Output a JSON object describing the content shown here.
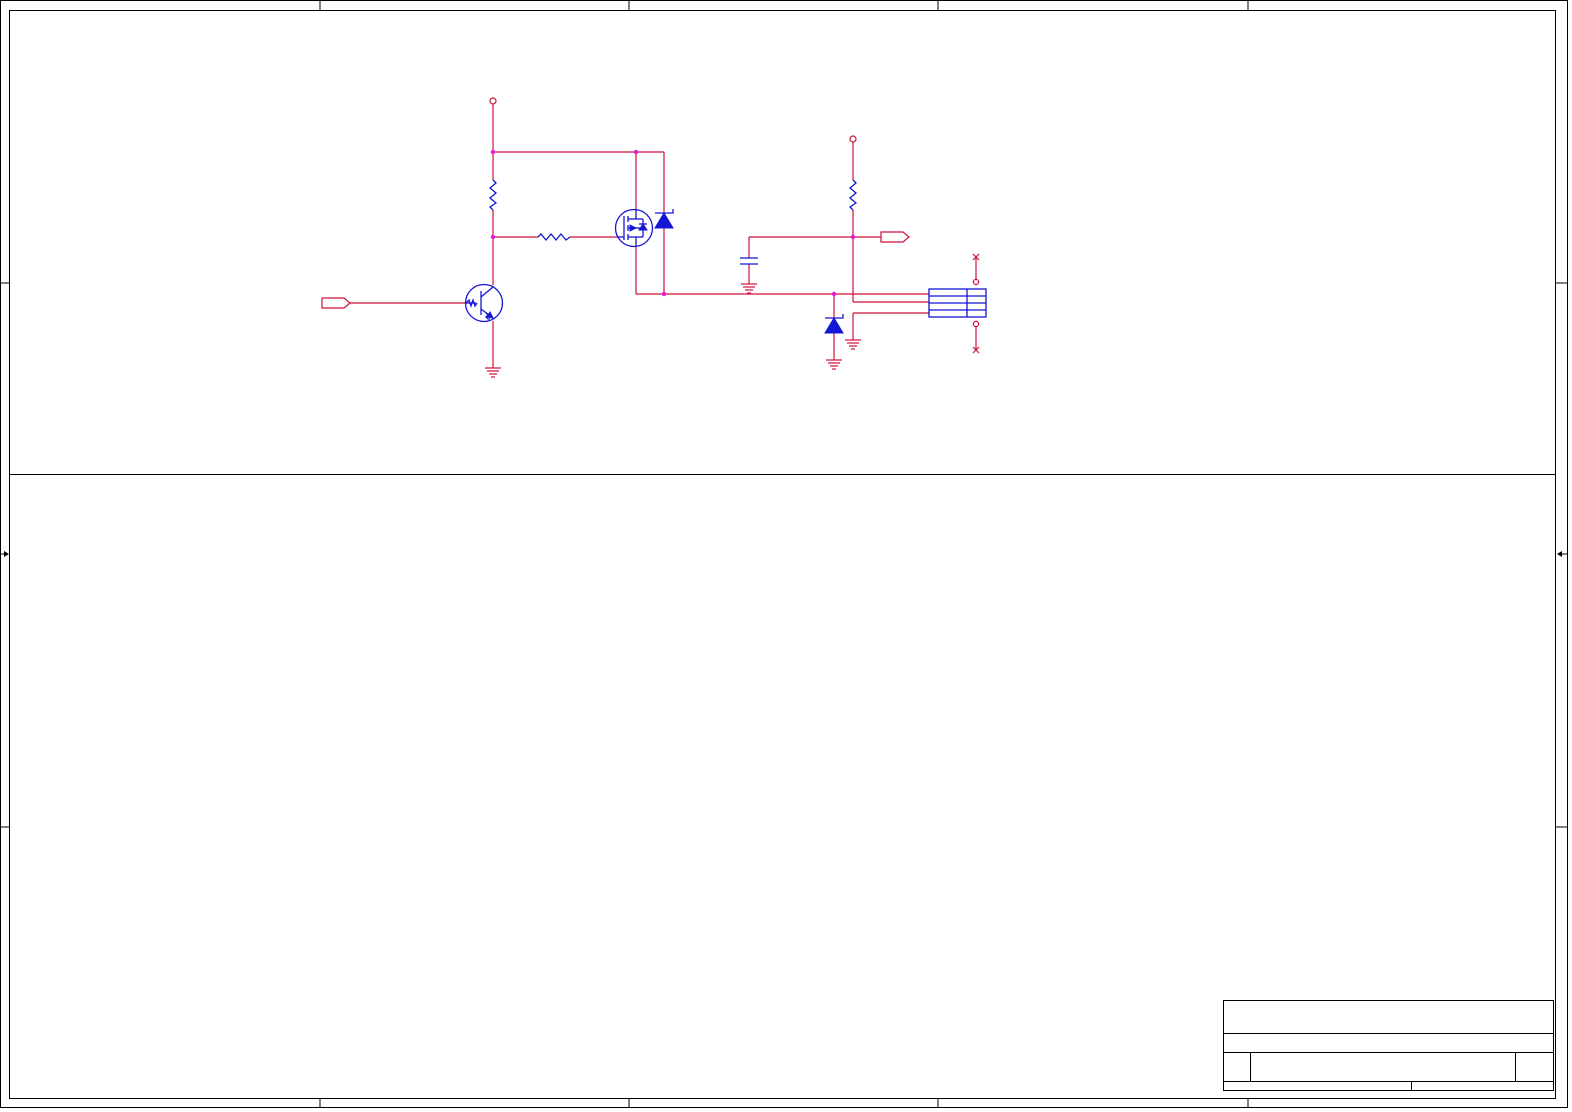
{
  "sheet": {
    "colors": {
      "wire": "#d0103a",
      "symbol": "#1515d6",
      "junction": "#e21ad8",
      "frame": "#000000",
      "background": "#ffffff"
    }
  },
  "components": [
    {
      "kind": "npn-transistor"
    },
    {
      "kind": "p-channel-mosfet"
    },
    {
      "kind": "resistor",
      "count": 3
    },
    {
      "kind": "capacitor"
    },
    {
      "kind": "zener-diode",
      "count": 2
    },
    {
      "kind": "connector-4-pin"
    },
    {
      "kind": "power-port",
      "count": 4
    },
    {
      "kind": "ground-symbol",
      "count": 4
    },
    {
      "kind": "net-port",
      "count": 2
    },
    {
      "kind": "no-connect-marker",
      "count": 2
    }
  ],
  "title_block": {}
}
